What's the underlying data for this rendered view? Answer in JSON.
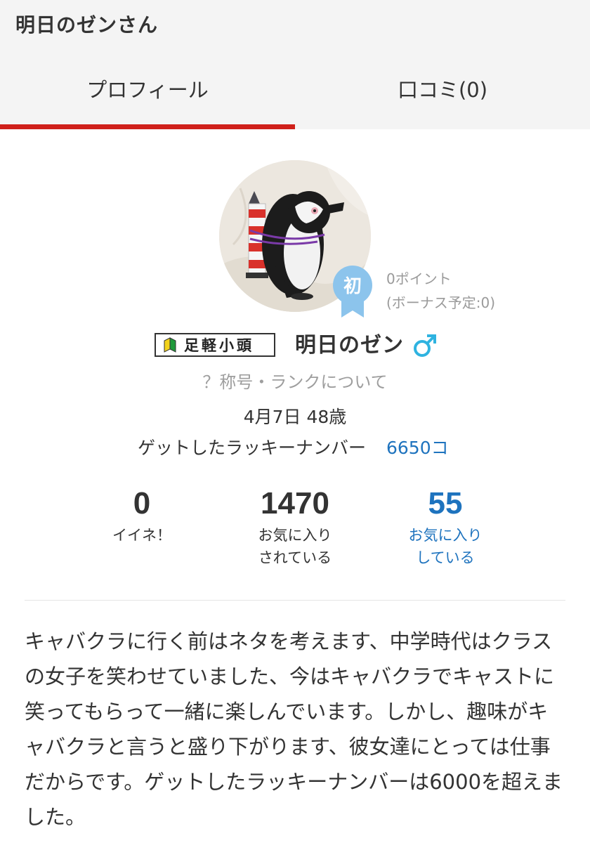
{
  "header": {
    "title": "明日のゼンさん"
  },
  "tabs": [
    {
      "label": "プロフィール",
      "active": true
    },
    {
      "label": "口コミ(0)",
      "active": false
    }
  ],
  "colors": {
    "accent": "#d0201a",
    "link": "#1e73be",
    "gender": "#2fb3e0",
    "badge": "#8cc4ec"
  },
  "profile": {
    "badge_label": "初",
    "points": "0ポイント",
    "bonus": "(ボーナス予定:0)",
    "rank_title": "足軽小頭",
    "name": "明日のゼン",
    "gender_icon": "male-symbol-icon",
    "rank_link": "？称号・ランクについて",
    "birthday": "4月7日 48歳",
    "lucky_label": "ゲットしたラッキーナンバー",
    "lucky_value": "6650コ"
  },
  "stats": [
    {
      "value": "0",
      "label_line1": "イイネ！",
      "label_line2": ""
    },
    {
      "value": "1470",
      "label_line1": "お気に入り",
      "label_line2": "されている"
    },
    {
      "value": "55",
      "label_line1": "お気に入り",
      "label_line2": "している"
    }
  ],
  "bio": "キャバクラに行く前はネタを考えます、中学時代はクラスの女子を笑わせていました、今はキャバクラでキャストに笑ってもらって一緒に楽しんでいます。しかし、趣味がキャバクラと言うと盛り下がります、彼女達にとっては仕事だからです。ゲットしたラッキーナンバーは6000を超えました。"
}
